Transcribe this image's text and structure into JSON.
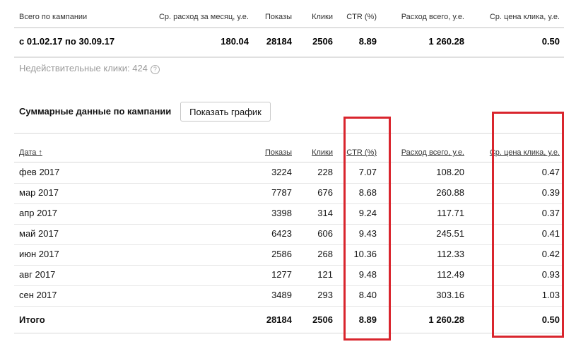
{
  "summary": {
    "headers": {
      "campaign": "Всего по кампании",
      "avg_month": "Ср. расход за месяц, у.е.",
      "shows": "Показы",
      "clicks": "Клики",
      "ctr": "CTR (%)",
      "total": "Расход всего, у.е.",
      "avg_click": "Ср. цена клика, у.е."
    },
    "row": {
      "period": "с 01.02.17 по 30.09.17",
      "avg_month": "180.04",
      "shows": "28184",
      "clicks": "2506",
      "ctr": "8.89",
      "total": "1 260.28",
      "avg_click": "0.50"
    }
  },
  "invalid_clicks": "Недействительные клики: 424",
  "section": {
    "title": "Суммарные данные по кампании",
    "button_label": "Показать график"
  },
  "table": {
    "headers": {
      "date": "Дата ↑",
      "shows": "Показы",
      "clicks": "Клики",
      "ctr": "CTR (%)",
      "total": "Расход всего, у.е.",
      "avg_click": "Ср. цена клика, у.е."
    },
    "rows": [
      {
        "date": "фев 2017",
        "shows": "3224",
        "clicks": "228",
        "ctr": "7.07",
        "total": "108.20",
        "avg_click": "0.47"
      },
      {
        "date": "мар 2017",
        "shows": "7787",
        "clicks": "676",
        "ctr": "8.68",
        "total": "260.88",
        "avg_click": "0.39"
      },
      {
        "date": "апр 2017",
        "shows": "3398",
        "clicks": "314",
        "ctr": "9.24",
        "total": "117.71",
        "avg_click": "0.37"
      },
      {
        "date": "май 2017",
        "shows": "6423",
        "clicks": "606",
        "ctr": "9.43",
        "total": "245.51",
        "avg_click": "0.41"
      },
      {
        "date": "июн 2017",
        "shows": "2586",
        "clicks": "268",
        "ctr": "10.36",
        "total": "112.33",
        "avg_click": "0.42"
      },
      {
        "date": "авг 2017",
        "shows": "1277",
        "clicks": "121",
        "ctr": "9.48",
        "total": "112.49",
        "avg_click": "0.93"
      },
      {
        "date": "сен 2017",
        "shows": "3489",
        "clicks": "293",
        "ctr": "8.40",
        "total": "303.16",
        "avg_click": "1.03"
      }
    ],
    "total": {
      "date": "Итого",
      "shows": "28184",
      "clicks": "2506",
      "ctr": "8.89",
      "total": "1 260.28",
      "avg_click": "0.50"
    }
  },
  "highlight_color": "#d9252d"
}
